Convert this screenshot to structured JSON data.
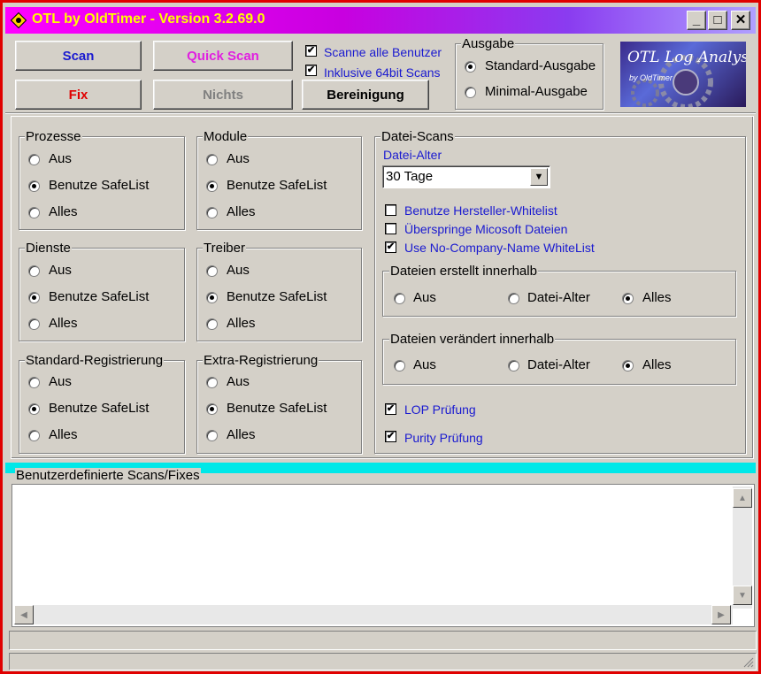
{
  "window": {
    "title": "OTL by OldTimer - Version 3.2.69.0"
  },
  "title_buttons": {
    "minimize": "_",
    "maximize": "□",
    "close": "✕"
  },
  "toolbar": {
    "scan": "Scan",
    "quick_scan": "Quick Scan",
    "fix": "Fix",
    "nichts": "Nichts",
    "bereinigung": "Bereinigung",
    "scanne_alle_benutzer": "Scanne alle Benutzer",
    "scanne_alle_benutzer_checked": true,
    "inklusive_64bit": "Inklusive 64bit Scans",
    "inklusive_64bit_checked": true,
    "colors": {
      "scan": "#1a1ad0",
      "quick_scan": "#e020e0",
      "fix": "#e00000",
      "nichts": "#808080"
    }
  },
  "ausgabe": {
    "legend": "Ausgabe",
    "standard": "Standard-Ausgabe",
    "minimal": "Minimal-Ausgabe",
    "selected": "standard"
  },
  "logo": {
    "text": "OTL Log Analysis",
    "subtext": "by OldTimer"
  },
  "groups": {
    "prozesse": {
      "legend": "Prozesse",
      "aus": "Aus",
      "safe": "Benutze SafeList",
      "alles": "Alles",
      "selected": "safe"
    },
    "module": {
      "legend": "Module",
      "aus": "Aus",
      "safe": "Benutze SafeList",
      "alles": "Alles",
      "selected": "safe"
    },
    "dienste": {
      "legend": "Dienste",
      "aus": "Aus",
      "safe": "Benutze SafeList",
      "alles": "Alles",
      "selected": "safe"
    },
    "treiber": {
      "legend": "Treiber",
      "aus": "Aus",
      "safe": "Benutze SafeList",
      "alles": "Alles",
      "selected": "safe"
    },
    "standard_reg": {
      "legend": "Standard-Registrierung",
      "aus": "Aus",
      "safe": "Benutze SafeList",
      "alles": "Alles",
      "selected": "safe"
    },
    "extra_reg": {
      "legend": "Extra-Registrierung",
      "aus": "Aus",
      "safe": "Benutze SafeList",
      "alles": "Alles",
      "selected": "safe"
    }
  },
  "datei_scans": {
    "legend": "Datei-Scans",
    "datei_alter_label": "Datei-Alter",
    "datei_alter_value": "30 Tage",
    "hersteller_whitelist": "Benutze Hersteller-Whitelist",
    "hersteller_whitelist_checked": false,
    "ueberspringe": "Überspringe Micosoft Dateien",
    "ueberspringe_checked": false,
    "no_company": "Use No-Company-Name WhiteList",
    "no_company_checked": true,
    "erstellt": {
      "legend": "Dateien erstellt innerhalb",
      "aus": "Aus",
      "datei_alter": "Datei-Alter",
      "alles": "Alles",
      "selected": "alles"
    },
    "veraendert": {
      "legend": "Dateien verändert innerhalb",
      "aus": "Aus",
      "datei_alter": "Datei-Alter",
      "alles": "Alles",
      "selected": "alles"
    },
    "lop": "LOP Prüfung",
    "lop_checked": true,
    "purity": "Purity Prüfung",
    "purity_checked": true
  },
  "custom_scans": {
    "legend": "Benutzerdefinierte Scans/Fixes",
    "content": ""
  },
  "scroll": {
    "up": "▲",
    "down": "▼",
    "left": "◀",
    "right": "▶"
  },
  "accent": {
    "title_gradient": "#ff00ff",
    "title_text": "#ffff00",
    "frame": "#e00000",
    "cyan_bar": "#00e8e8"
  }
}
